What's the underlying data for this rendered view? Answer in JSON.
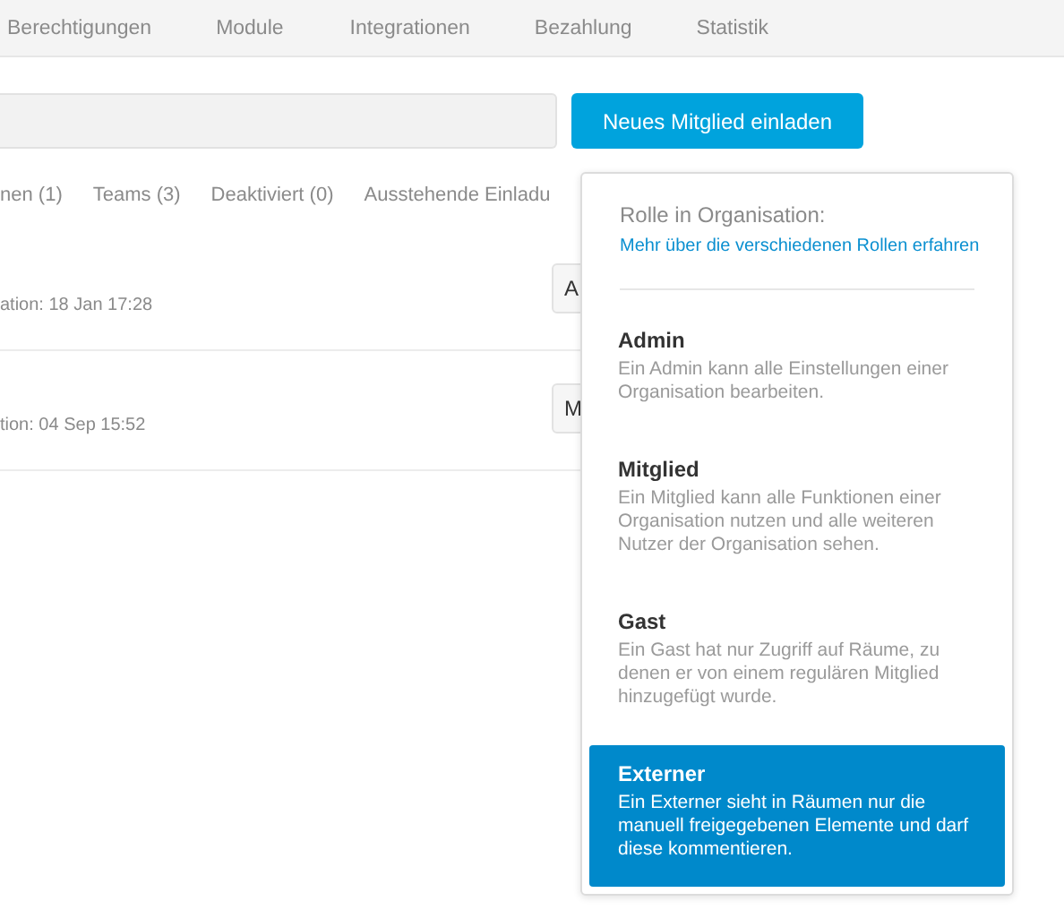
{
  "nav": {
    "items": [
      {
        "label": "Berechtigungen",
        "selected": false
      },
      {
        "label": "Module",
        "selected": false
      },
      {
        "label": "Integrationen",
        "selected": false
      },
      {
        "label": "Bezahlung",
        "selected": false
      },
      {
        "label": "Statistik",
        "selected": false
      }
    ]
  },
  "invite_button": "Neues Mitglied einladen",
  "tabs": [
    {
      "label": "nen (1)",
      "selected": false
    },
    {
      "label": "Teams (3)",
      "selected": false
    },
    {
      "label": "Deaktiviert (0)",
      "selected": false
    },
    {
      "label": "Ausstehende Einladu",
      "selected": false
    }
  ],
  "members": [
    {
      "meta": "ation: 18 Jan 17:28",
      "role": "A"
    },
    {
      "meta": "tion: 04 Sep 15:52",
      "role": "M"
    }
  ],
  "role_menu": {
    "heading": "Rolle in Organisation:",
    "link": "Mehr über die verschiedenen Rollen erfahren",
    "options": [
      {
        "name": "Admin",
        "description": "Ein Admin kann alle Einstellungen einer Organisation bearbeiten.",
        "selected": false
      },
      {
        "name": "Mitglied",
        "description": "Ein Mitglied kann alle Funktionen einer Organisation nutzen und alle weiteren Nutzer der Organisation sehen.",
        "selected": false
      },
      {
        "name": "Gast",
        "description": "Ein Gast hat nur Zugriff auf Räume, zu denen er von einem regulären Mitglied hinzugefügt wurde.",
        "selected": false
      },
      {
        "name": "Externer",
        "description": "Ein Externer sieht in Räumen nur die manuell freigegebenen Elemente und darf diese kommentieren.",
        "selected": true
      }
    ]
  }
}
